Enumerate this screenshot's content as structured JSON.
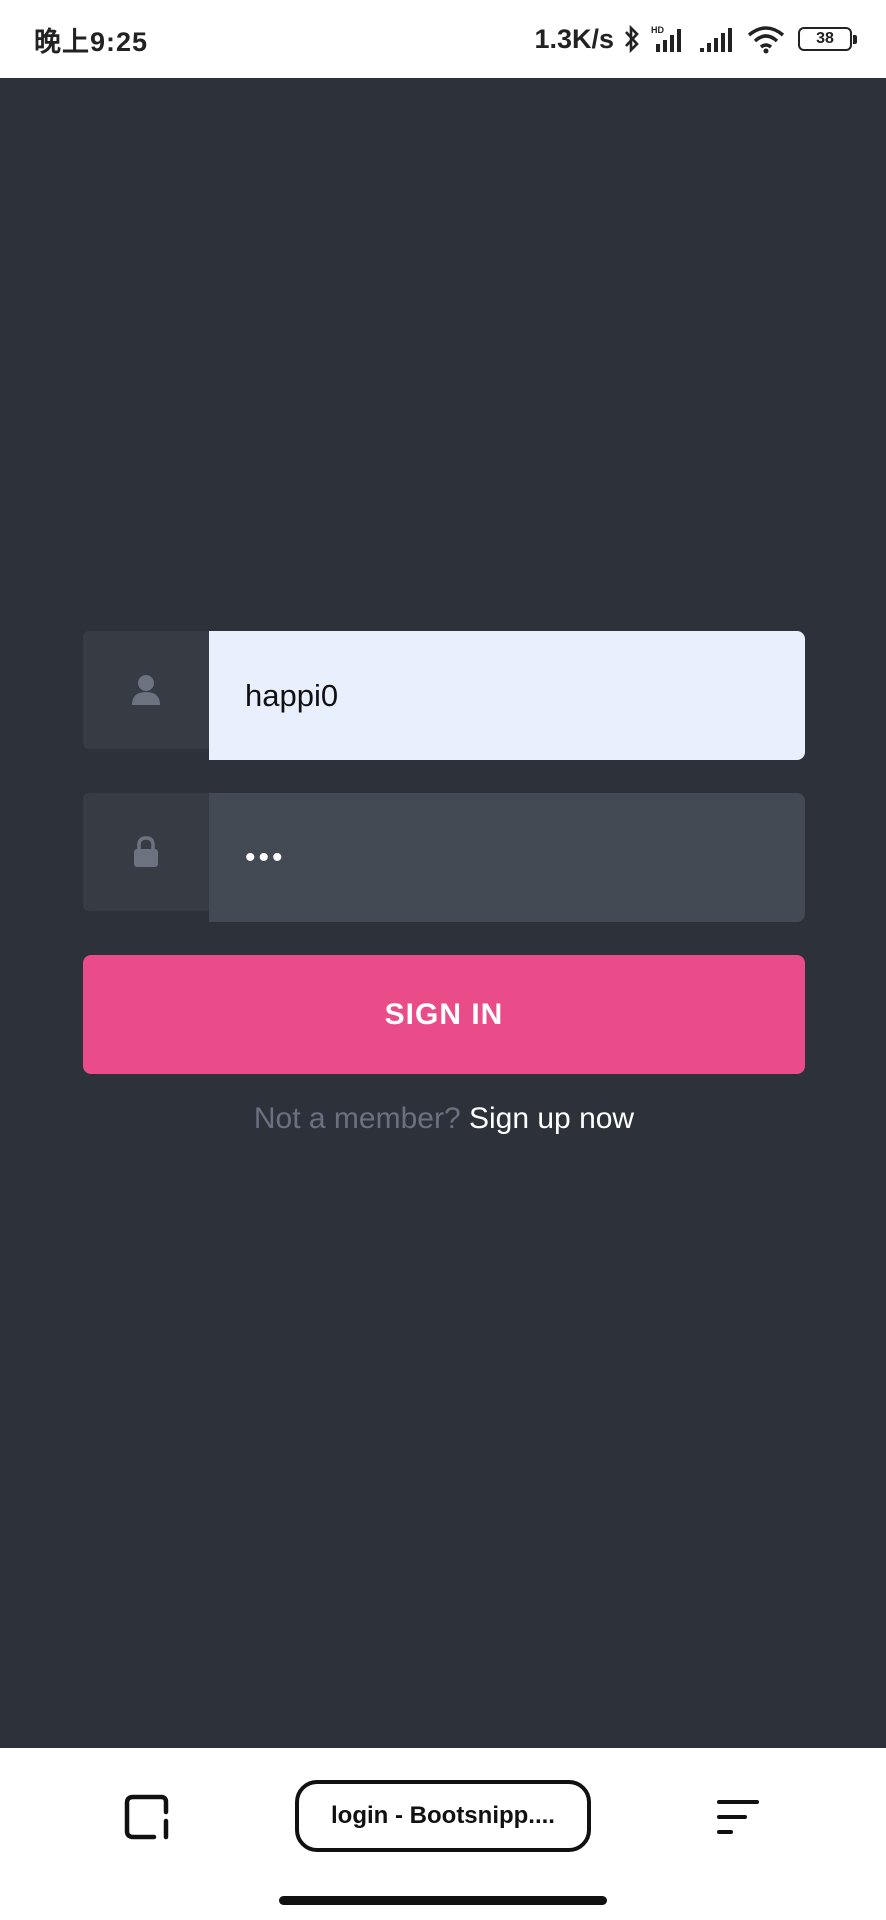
{
  "status_bar": {
    "time": "晚上9:25",
    "net_speed": "1.3K/s",
    "battery": "38",
    "icons": [
      "bluetooth-icon",
      "hd-signal-icon",
      "signal-icon",
      "wifi-icon",
      "battery-icon"
    ]
  },
  "login": {
    "username_value": "happi0",
    "password_value": "•••",
    "signin_label": "SIGN IN",
    "signup_prompt": "Not a member?",
    "signup_link": "Sign up now",
    "icons": [
      "user-icon",
      "lock-icon"
    ]
  },
  "browser": {
    "url_label": "login - Bootsnipp....",
    "icons": [
      "tabs-icon",
      "menu-icon"
    ]
  },
  "colors": {
    "background": "#2d323a",
    "accent": "#ea4c89",
    "autofill": "#e8f0fe"
  }
}
